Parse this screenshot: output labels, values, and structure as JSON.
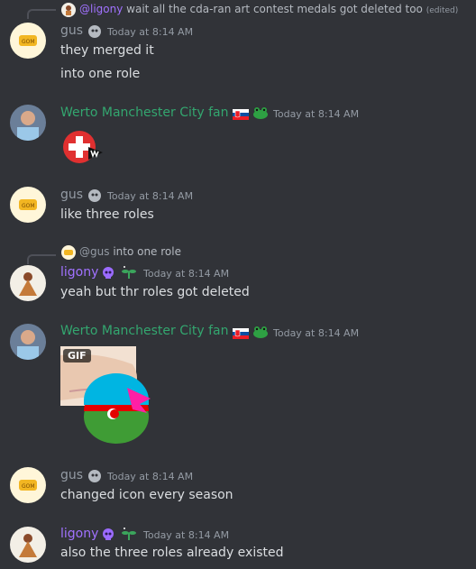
{
  "replies": [
    {
      "mention": "@ligony",
      "text": "wait all the cda-ran art contest medals got deleted too",
      "edited": "(edited)"
    },
    {
      "mention": "@gus",
      "text": "into one role"
    }
  ],
  "messages": {
    "m1": {
      "author": "gus",
      "timestamp": "Today at 8:14 AM",
      "lines": [
        "they merged it",
        "into one role"
      ]
    },
    "m2": {
      "author": "Werto Manchester City fan",
      "timestamp": "Today at 8:14 AM"
    },
    "m3": {
      "author": "gus",
      "timestamp": "Today at 8:14 AM",
      "lines": [
        "like three roles"
      ]
    },
    "m4": {
      "author": "ligony",
      "timestamp": "Today at 8:14 AM",
      "lines": [
        "yeah but thr roles got deleted"
      ]
    },
    "m5": {
      "author": "Werto Manchester City fan",
      "timestamp": "Today at 8:14 AM",
      "gif_label": "GIF"
    },
    "m6": {
      "author": "gus",
      "timestamp": "Today at 8:14 AM",
      "lines": [
        "changed icon every season"
      ]
    },
    "m7": {
      "author": "ligony",
      "timestamp": "Today at 8:14 AM",
      "lines": [
        "also the three roles already existed"
      ]
    }
  },
  "colors": {
    "background": "#313338",
    "gus": "#949ba4",
    "werto": "#33a66f",
    "ligony": "#a172ff"
  },
  "icons": [
    "reply-connector",
    "avatar",
    "robot-badge",
    "slovakia-flag-icon",
    "frog-emoji-icon",
    "purple-skull-emoji-icon",
    "plant-emoji-icon",
    "swiss-ball-sticker",
    "azerbaijan-ball-gif"
  ]
}
